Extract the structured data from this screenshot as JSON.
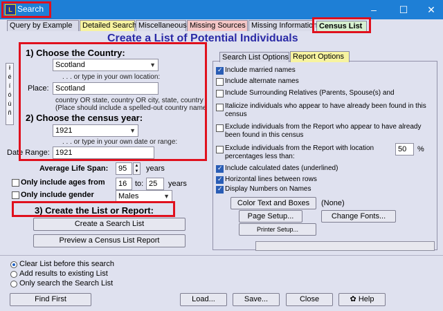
{
  "window": {
    "title": "Search",
    "icon_label": "L",
    "controls": [
      "–",
      "☐",
      "✕"
    ]
  },
  "tabs": [
    {
      "label": "Query by Example"
    },
    {
      "label": "Detailed Search"
    },
    {
      "label": "Miscellaneous"
    },
    {
      "label": "Missing Sources"
    },
    {
      "label": "Missing Information"
    },
    {
      "label": "Census List"
    }
  ],
  "heading": "Create a List of Potential Individuals",
  "accent_chars": [
    "ł",
    "é",
    "í",
    "ó",
    "ú",
    "ñ"
  ],
  "section1": {
    "title": "1) Choose the Country:",
    "country_select": "Scotland",
    "or_text": ". . . or type in your own location:",
    "place_label": "Place:",
    "place_value": "Scotland",
    "hint_line1": "country OR state, country OR city, state, country",
    "hint_line2": "(Place should include a spelled-out country name)"
  },
  "section2": {
    "title": "2) Choose the census year:",
    "year_select": "1921",
    "or_text": ". . . or type in your own date or range:",
    "date_range_label": "Date Range:",
    "date_range_value": "1921"
  },
  "lifespan": {
    "label": "Average Life Span:",
    "value": "95",
    "unit": "years"
  },
  "ages": {
    "label": "Only include ages from",
    "from": "16",
    "to_label": "to:",
    "to": "25",
    "unit": "years"
  },
  "gender": {
    "label": "Only include gender",
    "value": "Males"
  },
  "section3": {
    "title": "3) Create the List or Report:",
    "create_button": "Create a Search List",
    "preview_button": "Preview a Census List Report"
  },
  "options_tabs": [
    {
      "label": "Search List Options"
    },
    {
      "label": "Report Options"
    }
  ],
  "report_options": [
    {
      "text": "Include married names",
      "checked": true
    },
    {
      "text": "Include alternate names",
      "checked": false
    },
    {
      "text": "Include Surrounding Relatives (Parents, Spouse(s) and",
      "checked": false
    },
    {
      "text": "Italicize individuals who appear to have already been found in this census",
      "checked": false
    },
    {
      "text": "Exclude individuals from the Report who appear to have already been found in this census",
      "checked": false
    },
    {
      "text": "Exclude individuals from the Report with location percentages less than:",
      "checked": false
    },
    {
      "text": "Include calculated dates (underlined)",
      "checked": true
    },
    {
      "text": "Horizontal lines between rows",
      "checked": true
    },
    {
      "text": "Display Numbers on Names",
      "checked": true
    }
  ],
  "percent": {
    "value": "50",
    "unit": "%"
  },
  "report_buttons": {
    "color_text": "Color Text and Boxes",
    "none_label": "(None)",
    "page_setup": "Page Setup...",
    "change_fonts": "Change Fonts...",
    "printer_setup": "Printer Setup..."
  },
  "radios": [
    {
      "label": "Clear List before this search",
      "selected": true
    },
    {
      "label": "Add results to existing List",
      "selected": false
    },
    {
      "label": "Only search the Search List",
      "selected": false
    }
  ],
  "bottom_buttons": {
    "find_first": "Find First",
    "load": "Load...",
    "save": "Save...",
    "close": "Close",
    "help": "Help"
  },
  "colors": {
    "titlebar": "#1e7fd6",
    "highlight": "#e0101d",
    "heading": "#2a2aa6"
  }
}
